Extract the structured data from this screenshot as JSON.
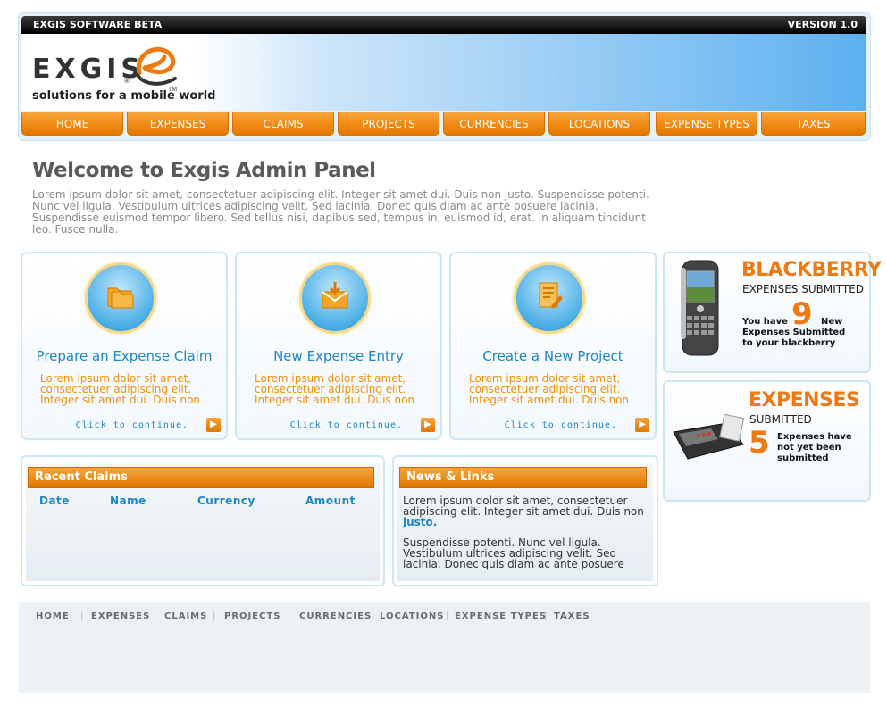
{
  "header": {
    "left_label": "EXGIS SOFTWARE BETA",
    "right_label": "VERSION 1.0",
    "logo_text": "EXGIS",
    "logo_registered": "®",
    "tagline": "solutions for a mobile world",
    "tagline_tm": "TM"
  },
  "nav": {
    "items": [
      "HOME",
      "EXPENSES",
      "CLAIMS",
      "PROJECTS",
      "CURRENCIES",
      "LOCATIONS",
      "EXPENSE TYPES",
      "TAXES"
    ]
  },
  "welcome": {
    "title": "Welcome to Exgis Admin Panel",
    "text": "Lorem ipsum dolor sit amet, consectetuer adipiscing elit. Integer sit amet dui. Duis non justo. Suspendisse potenti. Nunc vel ligula. Vestibulum ultrices adipiscing velit. Sed lacinia. Donec quis diam ac ante posuere lacinia. Suspendisse euismod tempor libero. Sed tellus nisi, dapibus sed, tempus in, euismod id, erat. In aliquam tincidunt leo. Fusce nulla."
  },
  "cards": [
    {
      "title": "Prepare an Expense Claim",
      "body": "Lorem ipsum dolor sit amet, consectetuer adipiscing elit. Integer sit amet dui. Duis non",
      "cta": "Click to continue.",
      "icon": "folders-icon"
    },
    {
      "title": "New Expense Entry",
      "body": "Lorem ipsum dolor sit amet, consectetuer adipiscing elit. Integer sit amet dui. Duis non",
      "cta": "Click to continue.",
      "icon": "envelope-download-icon"
    },
    {
      "title": "Create a New Project",
      "body": "Lorem ipsum dolor sit amet, consectetuer adipiscing elit. Integer sit amet dui. Duis non",
      "cta": "Click to continue.",
      "icon": "document-pen-icon"
    }
  ],
  "promo_blackberry": {
    "title": "BLACKBERRY",
    "subtitle": "EXPENSES SUBMITTED",
    "count": "9",
    "text_before": "You have",
    "text_after": "New Expenses Submitted to your blackberry"
  },
  "promo_expenses": {
    "title": "EXPENSES",
    "subtitle": "SUBMITTED",
    "count": "5",
    "text": "Expenses have not yet been submitted"
  },
  "recent_claims": {
    "title": "Recent Claims",
    "columns": [
      "Date",
      "Name",
      "Currency",
      "Amount"
    ]
  },
  "news": {
    "title": "News & Links",
    "para1": "Lorem ipsum dolor sit amet, consectetuer adipiscing elit. Integer sit amet dui. Duis non",
    "link": "justo.",
    "para2": "Suspendisse potenti. Nunc vel ligula. Vestibulum ultrices adipiscing velit. Sed lacinia. Donec quis diam ac ante posuere"
  },
  "footer_nav": {
    "items": [
      "HOME",
      "EXPENSES",
      "CLAIMS",
      "PROJECTS",
      "CURRENCIES",
      "LOCATIONS",
      "EXPENSE TYPES",
      "TAXES"
    ]
  },
  "colors": {
    "accent_orange": "#ef8a12",
    "link_blue": "#1d86c4",
    "banner_blue": "#5cb0ef"
  }
}
